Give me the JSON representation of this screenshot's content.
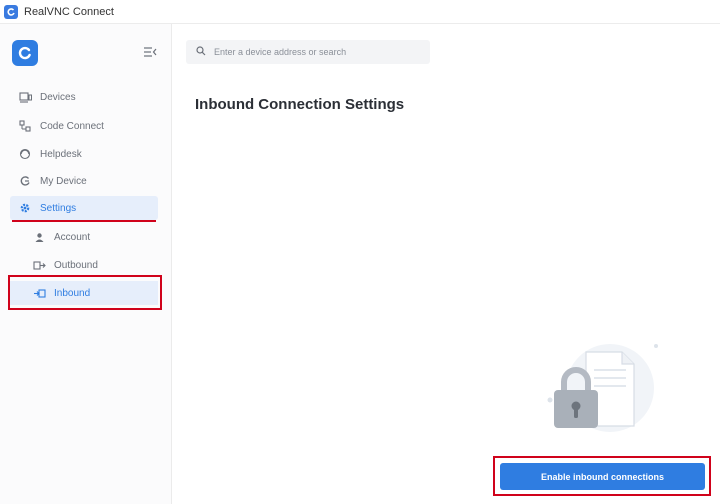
{
  "window": {
    "title": "RealVNC Connect"
  },
  "sidebar": {
    "items": [
      {
        "label": "Devices",
        "icon": "devices-icon"
      },
      {
        "label": "Code Connect",
        "icon": "code-connect-icon"
      },
      {
        "label": "Helpdesk",
        "icon": "helpdesk-icon"
      },
      {
        "label": "My Device",
        "icon": "my-device-icon"
      },
      {
        "label": "Settings",
        "icon": "gear-icon"
      }
    ],
    "settings_sub": [
      {
        "label": "Account",
        "icon": "user-icon"
      },
      {
        "label": "Outbound",
        "icon": "outbound-icon"
      },
      {
        "label": "Inbound",
        "icon": "inbound-icon"
      }
    ]
  },
  "search": {
    "placeholder": "Enter a device address or search"
  },
  "main": {
    "title": "Inbound Connection Settings",
    "enable_button": "Enable inbound connections"
  },
  "colors": {
    "accent": "#2f7de1",
    "highlight": "#d0021b"
  }
}
